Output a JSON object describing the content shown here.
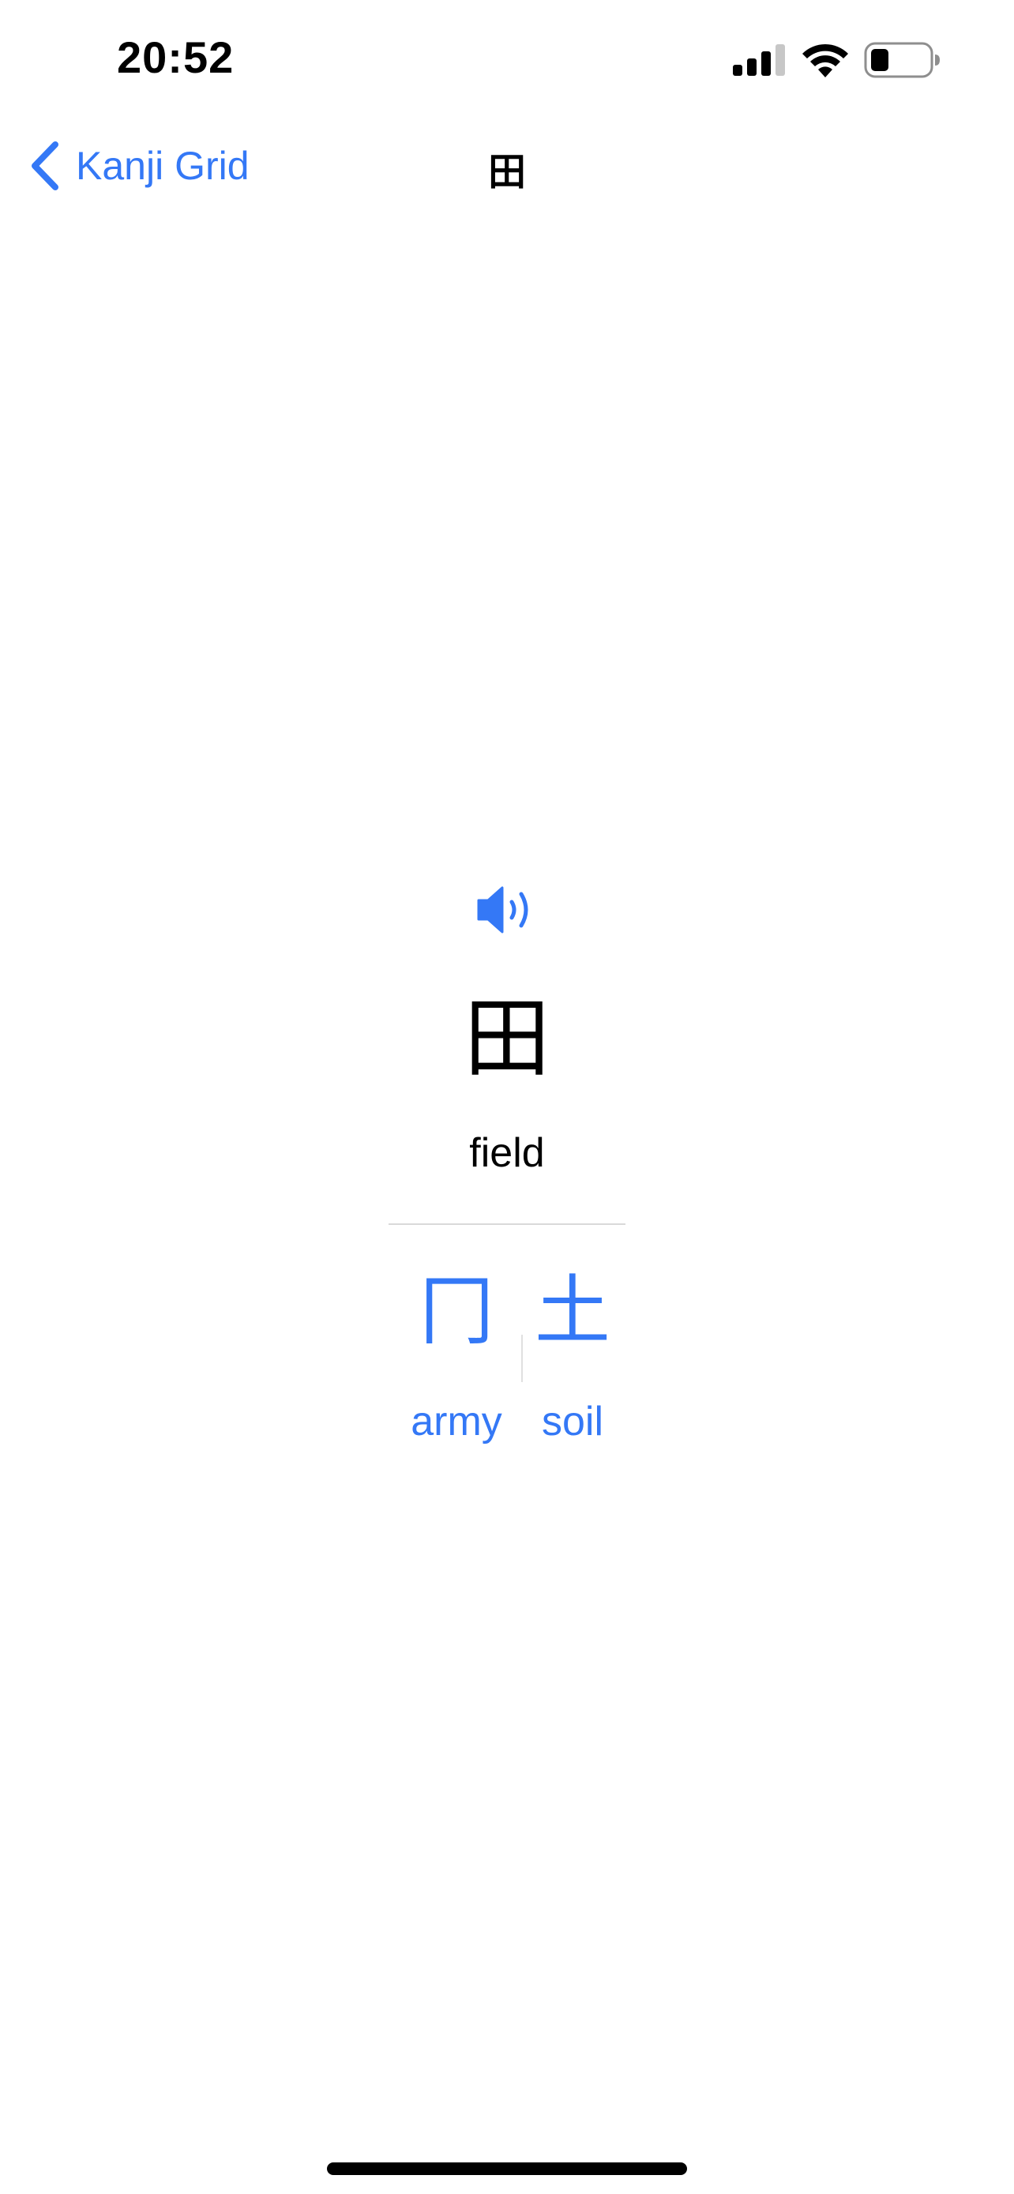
{
  "status_bar": {
    "time": "20:52",
    "signal_icon": "cellular-signal-icon",
    "wifi_icon": "wifi-icon",
    "battery_icon": "battery-low-icon"
  },
  "nav": {
    "back_label": "Kanji Grid",
    "back_icon": "chevron-left-icon",
    "title": "田"
  },
  "detail": {
    "speaker_icon": "speaker-volume-icon",
    "kanji": "田",
    "meaning": "field",
    "components": [
      {
        "kanji": "冂",
        "label": "army"
      },
      {
        "kanji": "土",
        "label": "soil"
      }
    ]
  },
  "colors": {
    "accent": "#3478f6",
    "text": "#000000",
    "background": "#ffffff",
    "divider": "#d9d9d9"
  }
}
